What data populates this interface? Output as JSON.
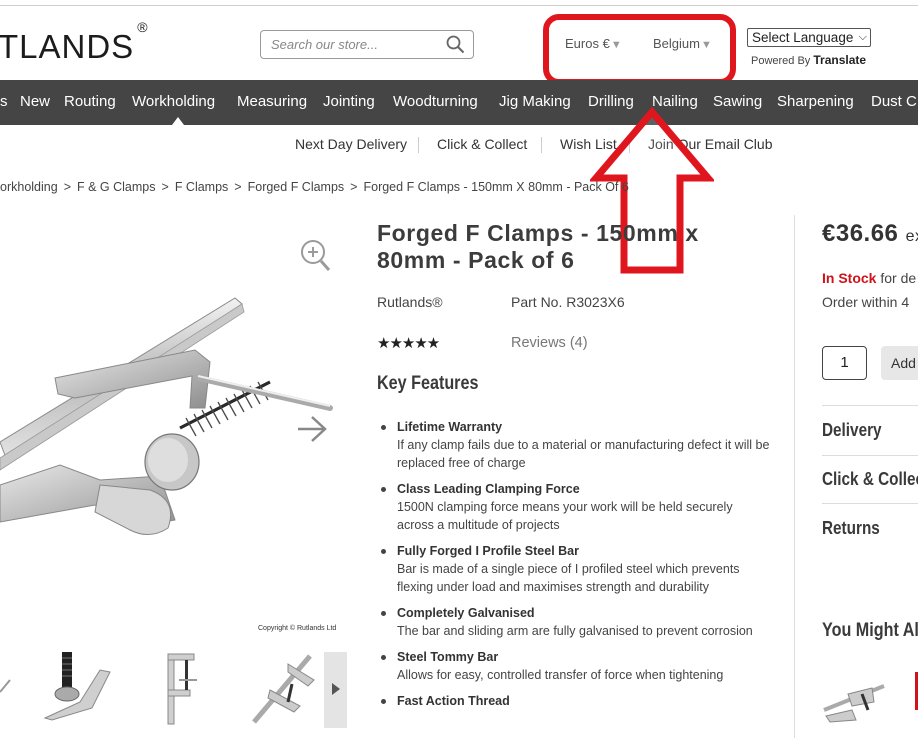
{
  "header": {
    "logo_text": "TLANDS",
    "logo_mark": "®",
    "search_placeholder": "Search our store...",
    "currency": "Euros €",
    "country": "Belgium",
    "language_select": "Select Language",
    "powered_by": "Powered By",
    "translate": "Translate"
  },
  "nav": {
    "items": [
      "s",
      "New",
      "Routing",
      "Workholding",
      "Measuring",
      "Jointing",
      "Woodturning",
      "Jig Making",
      "Drilling",
      "Nailing",
      "Sawing",
      "Sharpening",
      "Dust C"
    ],
    "active": "Workholding"
  },
  "subnav": {
    "items": [
      "Next Day Delivery",
      "Click & Collect",
      "Wish List",
      "Join Our Email Club"
    ]
  },
  "breadcrumb": {
    "items": [
      "orkholding",
      "F & G Clamps",
      "F Clamps",
      "Forged F Clamps",
      "Forged F Clamps - 150mm X 80mm - Pack Of 6"
    ],
    "separator": ">"
  },
  "product": {
    "title": "Forged F Clamps - 150mm x 80mm - Pack of 6",
    "brand": "Rutlands®",
    "part_no": "Part No. R3023X6",
    "rating_stars": "★★★★★",
    "reviews": "Reviews (4)",
    "image_copyright": "Copyright © Rutlands Ltd",
    "key_features_heading": "Key Features",
    "features": [
      {
        "title": "Lifetime Warranty",
        "text": "If any clamp fails due to a material or manufacturing defect it will be replaced free of charge"
      },
      {
        "title": "Class Leading Clamping Force",
        "text": "1500N clamping force means your work will be held securely across a multitude of projects"
      },
      {
        "title": "Fully Forged I Profile Steel Bar",
        "text": "Bar is made of a single piece of I profiled steel which prevents flexing under load and maximises strength and durability"
      },
      {
        "title": "Completely Galvanised",
        "text": "The bar and sliding arm are fully galvanised to prevent corrosion"
      },
      {
        "title": "Steel Tommy Bar",
        "text": "Allows for easy, controlled transfer of force when tightening"
      },
      {
        "title": "Fast Action Thread",
        "text": ""
      }
    ]
  },
  "buybox": {
    "price": "€36.66",
    "price_suffix": "ex",
    "in_stock": "In Stock",
    "in_stock_rest": "for de",
    "order_within": "Order within 4",
    "quantity": "1",
    "add_button": "Add",
    "accordion": [
      "Delivery",
      "Click & Collec",
      "Returns"
    ],
    "you_might": "You Might Al"
  },
  "colors": {
    "nav_bg": "#454545",
    "highlight_red": "#e0161e",
    "stock_red": "#d0121a"
  },
  "icons": [
    "search-icon",
    "zoom-in-icon",
    "next-arrow-icon",
    "chevron-right-icon",
    "up-arrow-annotation"
  ]
}
